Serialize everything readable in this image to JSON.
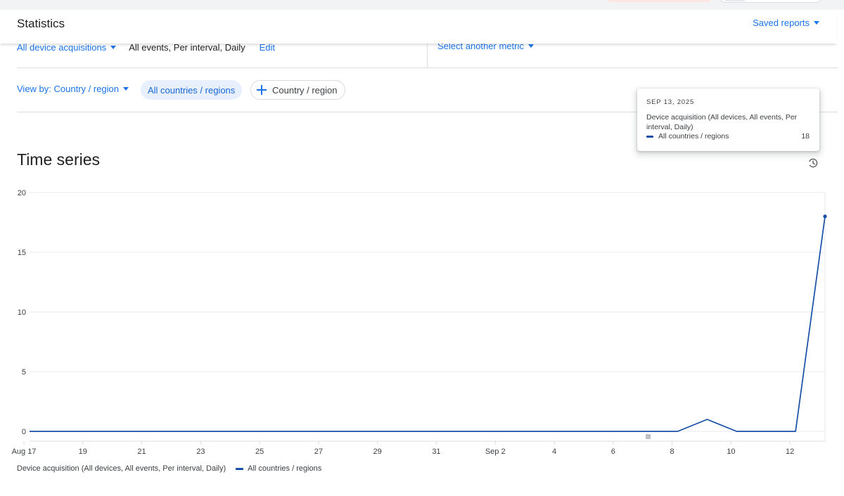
{
  "header": {
    "title": "Statistics",
    "saved_reports": "Saved reports"
  },
  "metric": {
    "acquisitions": "All device acquisitions",
    "description": "All events, Per interval, Daily",
    "edit": "Edit",
    "select_another": "Select another metric"
  },
  "view": {
    "view_by": "View by: Country / region",
    "chip_all": "All countries / regions",
    "chip_add": "Country / region"
  },
  "tooltip": {
    "date": "SEP 13, 2025",
    "metric": "Device acquisition (All devices, All events, Per interval, Daily)",
    "series_label": "All countries / regions",
    "value": "18"
  },
  "time_series": {
    "title": "Time series"
  },
  "legend": {
    "metric": "Device acquisition (All devices, All events, Per interval, Daily)",
    "series": "All countries / regions"
  },
  "colors": {
    "accent": "#1a73e8",
    "series": "#174ea6",
    "grid": "#e8eaed"
  },
  "chart_data": {
    "type": "line",
    "title": "Time series",
    "xlabel": "",
    "ylabel": "",
    "ylim": [
      0,
      20
    ],
    "yticks": [
      "0",
      "5",
      "10",
      "15",
      "20"
    ],
    "xticks": [
      "Aug 17",
      "19",
      "21",
      "23",
      "25",
      "27",
      "29",
      "31",
      "Sep 2",
      "4",
      "6",
      "8",
      "10",
      "12"
    ],
    "x": [
      "Aug 17",
      "Aug 18",
      "Aug 19",
      "Aug 20",
      "Aug 21",
      "Aug 22",
      "Aug 23",
      "Aug 24",
      "Aug 25",
      "Aug 26",
      "Aug 27",
      "Aug 28",
      "Aug 29",
      "Aug 30",
      "Aug 31",
      "Sep 1",
      "Sep 2",
      "Sep 3",
      "Sep 4",
      "Sep 5",
      "Sep 6",
      "Sep 7",
      "Sep 8",
      "Sep 9",
      "Sep 10",
      "Sep 11",
      "Sep 12",
      "Sep 13"
    ],
    "series": [
      {
        "name": "All countries / regions",
        "values": [
          0,
          0,
          0,
          0,
          0,
          0,
          0,
          0,
          0,
          0,
          0,
          0,
          0,
          0,
          0,
          0,
          0,
          0,
          0,
          0,
          0,
          0,
          0,
          1,
          0,
          0,
          0,
          18
        ]
      }
    ],
    "grid": true,
    "legend": "bottom-left"
  }
}
